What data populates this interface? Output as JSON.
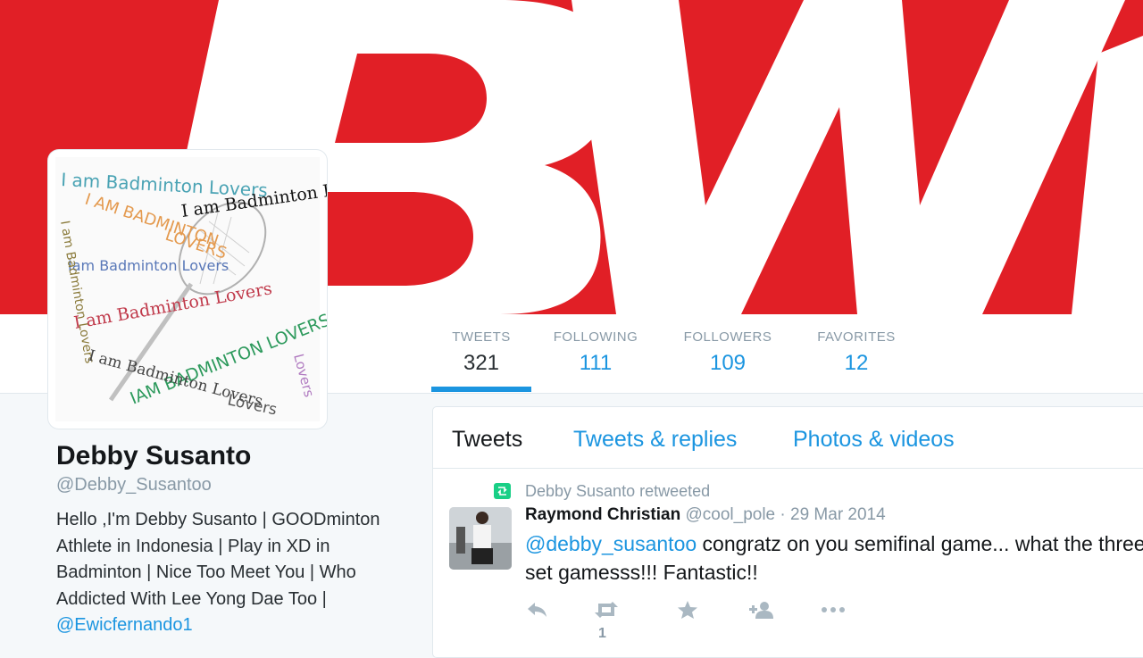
{
  "profile": {
    "name": "Debby Susanto",
    "handle": "@Debby_Susantoo",
    "bio_text": "Hello ,I'm Debby Susanto | GOODminton Athlete in Indonesia | Play in XD in Badminton | Nice Too Meet You | Who Addicted With Lee Yong Dae Too |",
    "bio_mention": "@Ewicfernando1"
  },
  "stats": [
    {
      "label": "TWEETS",
      "value": "321"
    },
    {
      "label": "FOLLOWING",
      "value": "111"
    },
    {
      "label": "FOLLOWERS",
      "value": "109"
    },
    {
      "label": "FAVORITES",
      "value": "12"
    }
  ],
  "tabs": [
    {
      "label": "Tweets"
    },
    {
      "label": "Tweets & replies"
    },
    {
      "label": "Photos & videos"
    }
  ],
  "tweet": {
    "retweet_context": "Debby Susanto retweeted",
    "author_name": "Raymond Christian",
    "author_handle": "@cool_pole",
    "time": "· 29 Mar 2014",
    "mention": "@debby_susantoo",
    "text_line1": " congratz on you semifinal game... what the three",
    "text_line2": "set gamesss!!! Fantastic!!",
    "retweet_count": "1"
  },
  "avatar_phrases": [
    "I am Badminton Lovers",
    "I am Badminton Lov",
    "I AM BADMINTON",
    "LOVERS",
    "Iam Badminton Lovers",
    "I am Badminton Lovers",
    "I am Badminton Lovers",
    "IAM BADMINTON LOVERS",
    "I am Badminton Lovers",
    "Lovers",
    "Lovers"
  ],
  "colors": {
    "banner_red": "#e11f26",
    "twitter_blue": "#1b95e0",
    "retweet_green": "#19cf86"
  },
  "icons": {
    "reply": "reply-icon",
    "retweet": "retweet-icon",
    "favorite": "star-icon",
    "follow": "add-user-icon",
    "more": "more-icon"
  }
}
